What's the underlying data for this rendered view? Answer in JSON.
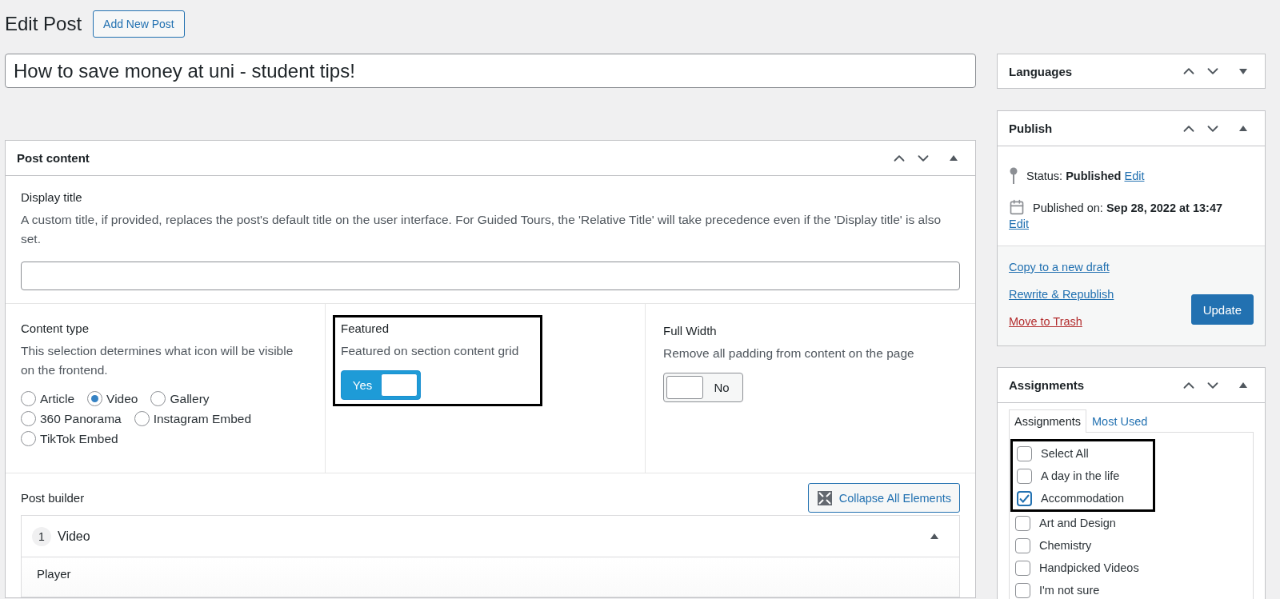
{
  "header": {
    "title": "Edit Post",
    "add_button": "Add New Post"
  },
  "post_title": {
    "value": "How to save money at uni - student tips!"
  },
  "post_content": {
    "title": "Post content",
    "expanded": true,
    "display_title": {
      "label": "Display title",
      "description": "A custom title, if provided, replaces the post's default title on the user interface. For Guided Tours, the 'Relative Title' will take precedence even if the 'Display title' is also set."
    },
    "content_type": {
      "label": "Content type",
      "description": "This selection determines what icon will be visible on the frontend.",
      "options": [
        {
          "label": "Article",
          "selected": false
        },
        {
          "label": "Video",
          "selected": true
        },
        {
          "label": "Gallery",
          "selected": false
        },
        {
          "label": "360 Panorama",
          "selected": false
        },
        {
          "label": "Instagram Embed",
          "selected": false
        },
        {
          "label": "TikTok Embed",
          "selected": false
        }
      ]
    },
    "featured": {
      "label": "Featured",
      "description": "Featured on section content grid",
      "toggle_label": "Yes",
      "on": true,
      "highlighted": true
    },
    "full_width": {
      "label": "Full Width",
      "description": "Remove all padding from content on the page",
      "toggle_label": "No",
      "on": false,
      "highlighted": false
    },
    "post_builder": {
      "label": "Post builder",
      "collapse_button": "Collapse All Elements",
      "elements": [
        {
          "number": "1",
          "title": "Video",
          "expanded": true,
          "fields": [
            "Player"
          ]
        }
      ]
    }
  },
  "sidebar": {
    "languages": {
      "title": "Languages",
      "expanded": false
    },
    "publish": {
      "title": "Publish",
      "expanded": true,
      "status_label": "Status:",
      "status": "Published",
      "status_edit": "Edit",
      "date_label": "Published on:",
      "date": "Sep 28, 2022 at 13:47",
      "date_edit": "Edit",
      "links": [
        {
          "label": "Copy to a new draft",
          "kind": "normal"
        },
        {
          "label": "Rewrite & Republish",
          "kind": "normal"
        },
        {
          "label": "Move to Trash",
          "kind": "danger"
        }
      ],
      "update_button": "Update"
    },
    "assignments": {
      "title": "Assignments",
      "expanded": true,
      "tabs": [
        {
          "label": "Assignments",
          "selected": true
        },
        {
          "label": "Most Used",
          "selected": false
        }
      ],
      "items": [
        {
          "label": "Select All",
          "checked": false,
          "highlighted": true
        },
        {
          "label": "A day in the life",
          "checked": false,
          "highlighted": true
        },
        {
          "label": "Accommodation",
          "checked": true,
          "highlighted": true
        },
        {
          "label": "Art and Design",
          "checked": false,
          "highlighted": false
        },
        {
          "label": "Chemistry",
          "checked": false,
          "highlighted": false
        },
        {
          "label": "Handpicked Videos",
          "checked": false,
          "highlighted": false
        },
        {
          "label": "I'm not sure",
          "checked": false,
          "highlighted": false
        }
      ]
    }
  }
}
